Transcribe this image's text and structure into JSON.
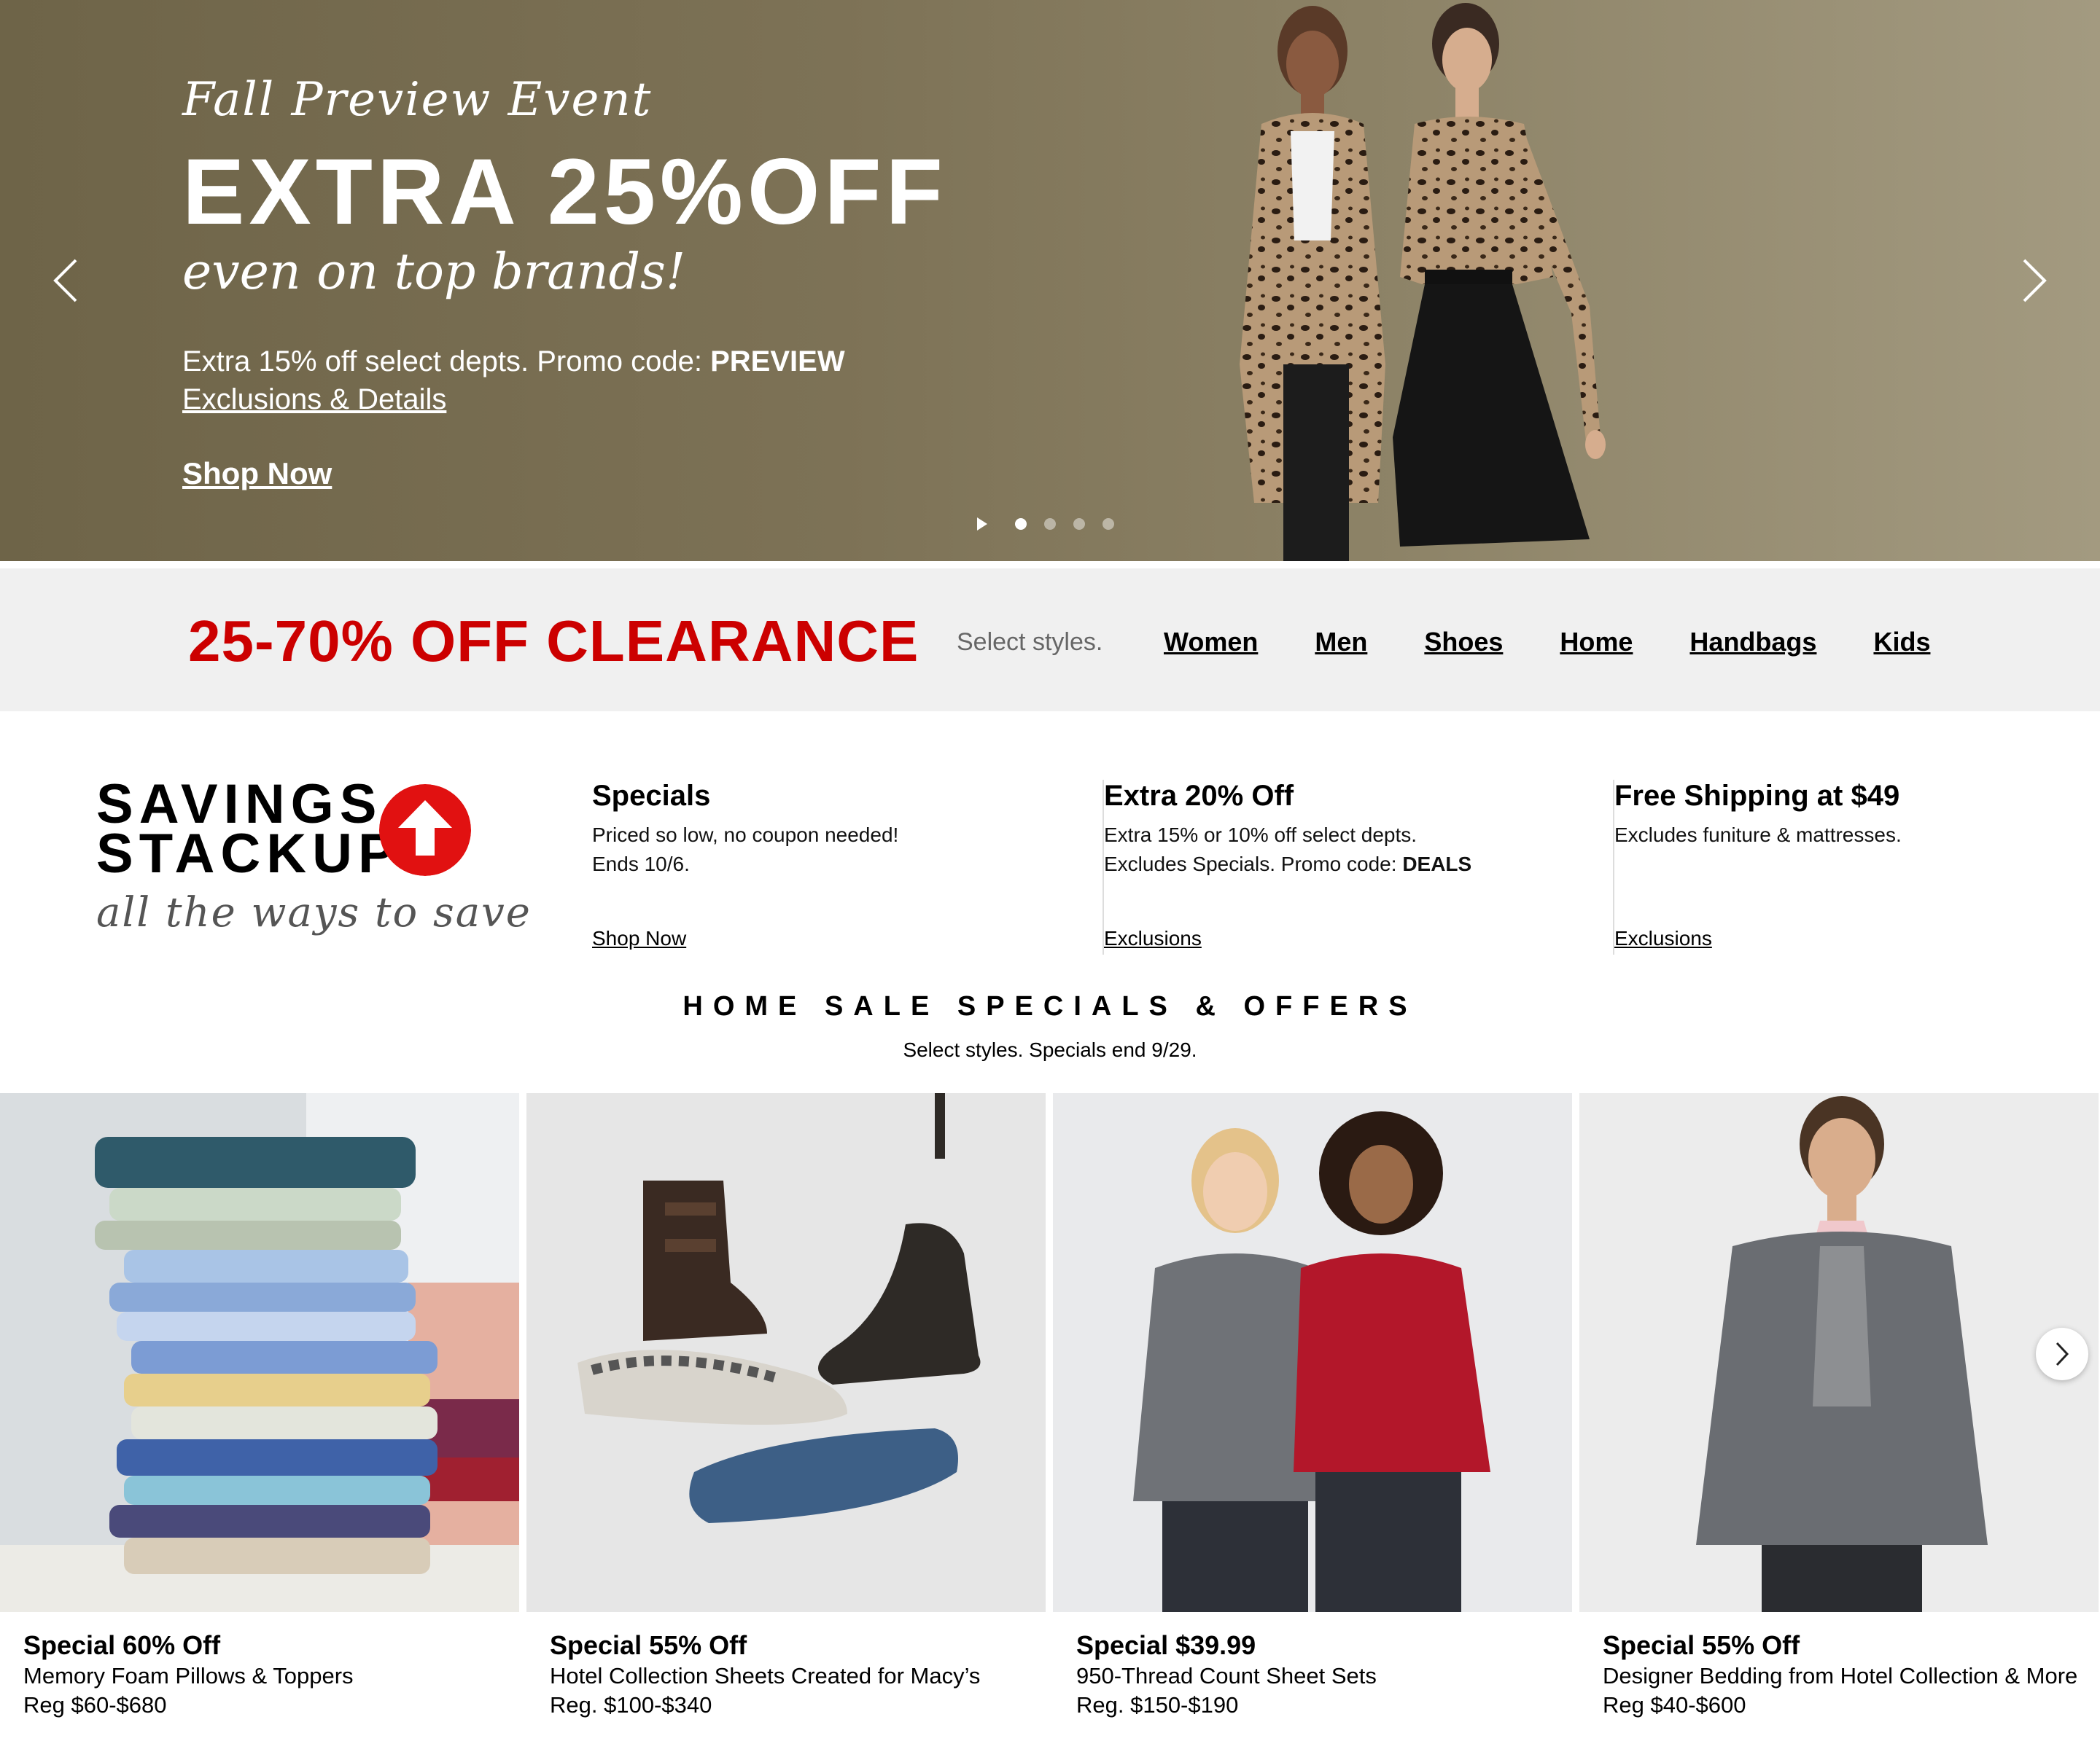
{
  "hero": {
    "eyebrow": "Fall Preview Event",
    "headline": "EXTRA 25%OFF",
    "subhead": "even on top brands!",
    "promo_text": "Extra 15% off select depts. Promo code: ",
    "promo_code": "PREVIEW",
    "details_link": "Exclusions & Details",
    "shop_link": "Shop Now",
    "prev_icon": "chevron-left-icon",
    "next_icon": "chevron-right-icon",
    "slides_total": 4,
    "slide_active": 1
  },
  "clearance": {
    "title": "25-70% OFF CLEARANCE",
    "select_text": "Select styles.",
    "links": [
      "Women",
      "Men",
      "Shoes",
      "Home",
      "Handbags",
      "Kids"
    ]
  },
  "savings": {
    "logo_line1": "SAVINGS",
    "logo_line2": "STACKUP",
    "logo_tagline": "all the ways to save",
    "logo_icon": "arrow-up-icon",
    "offers": [
      {
        "title": "Specials",
        "line1": "Priced so low, no coupon needed!",
        "line2": "Ends 10/6.",
        "link": "Shop Now"
      },
      {
        "title": "Extra 20% Off",
        "line1": "Extra 15% or 10% off select depts.",
        "line2_prefix": "Excludes Specials. Promo code: ",
        "line2_code": "DEALS",
        "link": "Exclusions"
      },
      {
        "title": "Free Shipping at $49",
        "line1": "Excludes funiture & mattresses.",
        "link": "Exclusions"
      }
    ]
  },
  "home_sale": {
    "title": "HOME SALE SPECIALS & OFFERS",
    "subtitle": "Select styles. Specials end 9/29."
  },
  "products": [
    {
      "deal": "Special 60% Off",
      "desc": "Memory Foam Pillows & Toppers",
      "reg": "Reg $60-$680",
      "image": "stacked-sheets-photo"
    },
    {
      "deal": "Special 55% Off",
      "desc": "Hotel Collection Sheets Created for Macy’s",
      "reg": "Reg. $100-$340",
      "image": "shoes-assortment-photo"
    },
    {
      "deal": "Special $39.99",
      "desc": "950-Thread Count Sheet Sets",
      "reg": "Reg. $150-$190",
      "image": "puffer-jackets-photo"
    },
    {
      "deal": "Special 55% Off",
      "desc": "Designer Bedding from Hotel Collection & More",
      "reg": "Reg $40-$600",
      "image": "mens-blazer-photo"
    }
  ],
  "carousel_next_icon": "chevron-right-icon",
  "colors": {
    "clearance_red": "#cc0000",
    "hero_bg": "#7d7256",
    "bar_bg": "#f0f0f0",
    "stackup_red": "#e11111"
  }
}
